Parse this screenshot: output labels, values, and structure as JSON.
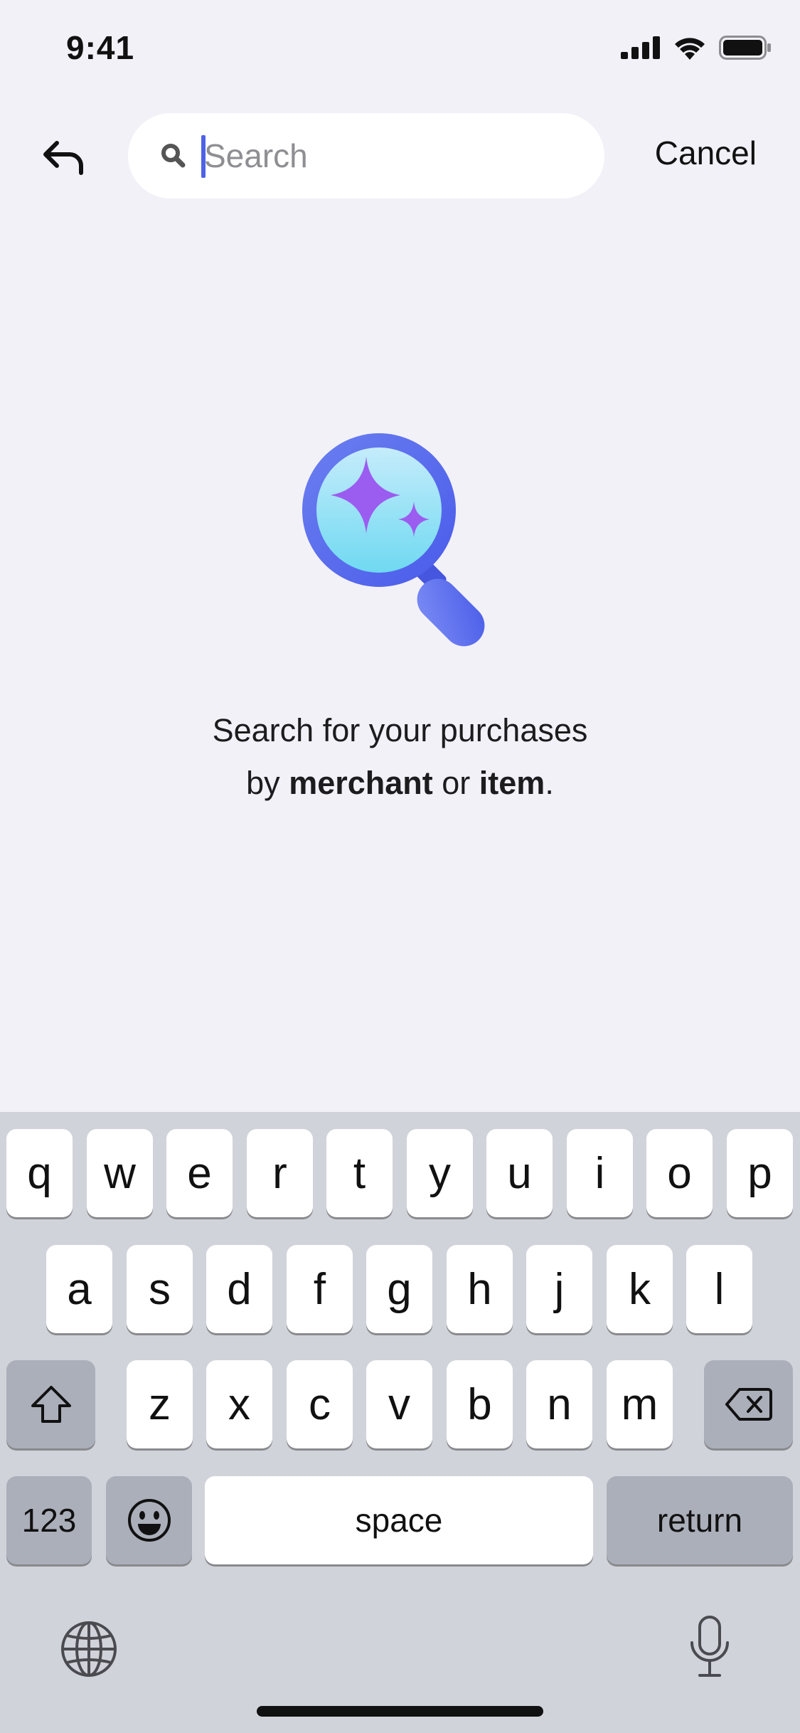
{
  "status_bar": {
    "time": "9:41"
  },
  "header": {
    "search_placeholder": "Search",
    "search_value": "",
    "cancel_label": "Cancel"
  },
  "empty_state": {
    "line1": "Search for your purchases",
    "line2_prefix": "by ",
    "line2_merchant": "merchant",
    "line2_middle": " or ",
    "line2_item": "item",
    "line2_suffix": "."
  },
  "keyboard": {
    "row1": [
      "q",
      "w",
      "e",
      "r",
      "t",
      "y",
      "u",
      "i",
      "o",
      "p"
    ],
    "row2": [
      "a",
      "s",
      "d",
      "f",
      "g",
      "h",
      "j",
      "k",
      "l"
    ],
    "row3": [
      "z",
      "x",
      "c",
      "v",
      "b",
      "n",
      "m"
    ],
    "numbers_label": "123",
    "space_label": "space",
    "return_label": "return"
  },
  "colors": {
    "accent": "#4d62e5",
    "background": "#f2f1f7",
    "keyboard": "#d1d3da"
  },
  "icons": [
    "back-arrow-icon",
    "search-icon",
    "sparkle-magnifier-icon",
    "shift-icon",
    "backspace-icon",
    "emoji-icon",
    "globe-icon",
    "microphone-icon",
    "signal-icon",
    "wifi-icon",
    "battery-icon"
  ]
}
